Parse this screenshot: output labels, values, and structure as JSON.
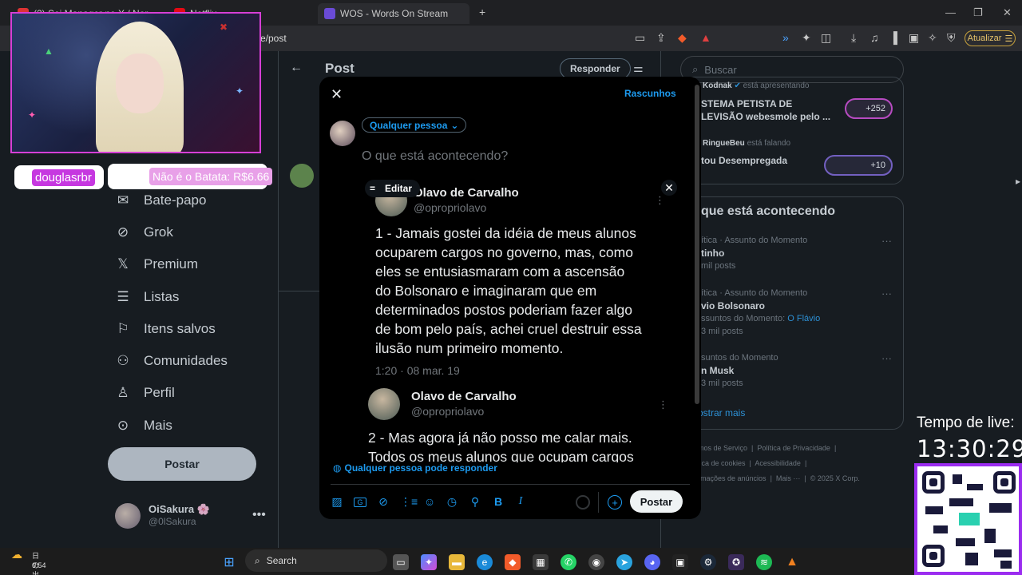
{
  "browser": {
    "tabs": [
      {
        "title": "(2) Sei Manager no X / Nor..."
      },
      {
        "title": "Netflix"
      },
      {
        "title": "WOS - Words On Stream"
      }
    ],
    "url_visible": "e/post",
    "update_label": "Atualizar"
  },
  "x": {
    "page_title": "Post",
    "reply_label": "Responder",
    "search_placeholder": "Buscar",
    "nav": [
      {
        "label": "Bate-papo",
        "icon": "mail-icon"
      },
      {
        "label": "Grok",
        "icon": "grok-icon"
      },
      {
        "label": "Premium",
        "icon": "x-logo-icon"
      },
      {
        "label": "Listas",
        "icon": "list-icon"
      },
      {
        "label": "Itens salvos",
        "icon": "bookmark-icon"
      },
      {
        "label": "Comunidades",
        "icon": "communities-icon"
      },
      {
        "label": "Perfil",
        "icon": "profile-icon"
      },
      {
        "label": "Mais",
        "icon": "more-icon"
      }
    ],
    "post_button": "Postar",
    "profile": {
      "name": "OiSakura 🌸",
      "handle": "@0lSakura"
    },
    "spaces": [
      {
        "host": "Kodnak",
        "status": "está apresentando",
        "title": "STEMA PETISTA DE LEVISÃO webesmole pelo ...",
        "count": "+252"
      },
      {
        "host": "RingueBeu",
        "status": "está falando",
        "title": "tou Desempregada",
        "count": "+10"
      }
    ],
    "trends_title": "que está acontecendo",
    "trends": [
      {
        "meta": "ítica · Assunto do Momento",
        "name": "tinho",
        "sub": "",
        "posts": "mil posts"
      },
      {
        "meta": "ítica · Assunto do Momento",
        "name": "vio Bolsonaro",
        "sub": "ssuntos do Momento:",
        "sub_link": "O Flávio",
        "posts": "3 mil posts"
      },
      {
        "meta": "suntos do Momento",
        "name": "n Musk",
        "sub": "",
        "posts": "3 mil posts"
      }
    ],
    "show_more": "ostrar mais",
    "footer": [
      "mos de Serviço",
      "Política de Privacidade",
      "tica de cookies",
      "Acessibilidade",
      "rmações de anúncios",
      "Mais ···",
      "© 2025 X Corp."
    ]
  },
  "modal": {
    "drafts": "Rascunhos",
    "audience": "Qualquer pessoa",
    "placeholder": "O que está acontecendo?",
    "edit_label": "Editar",
    "tweets": [
      {
        "name": "Olavo de Carvalho",
        "handle": "@opropriolavo",
        "lines": [
          "1 - Jamais gostei da idéia de meus alunos",
          "ocuparem cargos no governo, mas, como",
          "eles se entusiasmaram com a ascensão",
          "do Bolsonaro e imaginaram que em",
          "determinados postos poderiam fazer algo",
          "de bom pelo país, achei cruel destruir essa",
          "ilusão num primeiro momento."
        ],
        "time": "1:20 · 08 mar. 19"
      },
      {
        "name": "Olavo de Carvalho",
        "handle": "@opropriolavo",
        "lines": [
          "2 - Mas agora já não posso me calar mais.",
          "Todos os meus alunos que ocupam cargos"
        ]
      }
    ],
    "reply_permission": "Qualquer pessoa pode responder",
    "post_label": "Postar",
    "toolbar_icons": [
      "image-icon",
      "gif-icon",
      "grok-icon",
      "poll-icon",
      "emoji-icon",
      "schedule-icon",
      "location-icon",
      "bold-icon",
      "italic-icon"
    ]
  },
  "stream": {
    "alert_user": "douglasrbr",
    "alert_msg": "Não é o Batata: R$6.66",
    "live_label": "Tempo de live:",
    "live_time": "13:30:29"
  },
  "taskbar": {
    "weather_line1": "日の出です",
    "weather_line2": "6:54",
    "search_label": "Search"
  },
  "colors": {
    "x_blue": "#1d9bf0",
    "accent_pink": "#d63fd6",
    "qr_border": "#9b2cf0"
  }
}
